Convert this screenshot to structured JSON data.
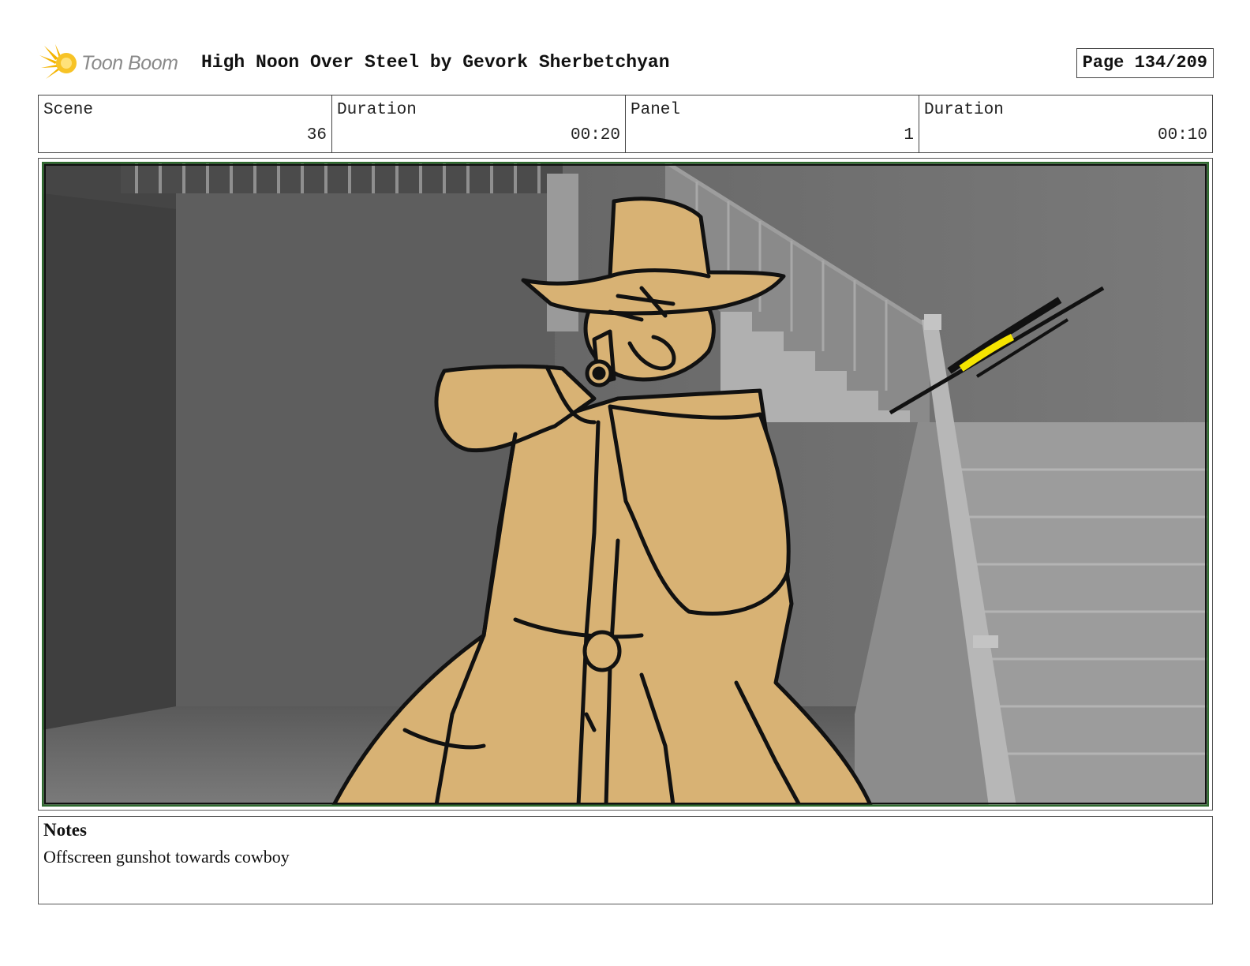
{
  "header": {
    "logo_text": "Toon Boom",
    "title": "High Noon Over Steel by Gevork Sherbetchyan",
    "page": "Page 134/209"
  },
  "info": {
    "scene_label": "Scene",
    "scene_value": "36",
    "scene_duration_label": "Duration",
    "scene_duration_value": "00:20",
    "panel_label": "Panel",
    "panel_value": "1",
    "panel_duration_label": "Duration",
    "panel_duration_value": "00:10"
  },
  "colors": {
    "figure_fill": "#d8b274",
    "background_gray": "#6e6e6e",
    "frame_border": "#2f6b2f",
    "muzzle_flash": "#f5e400"
  },
  "notes": {
    "title": "Notes",
    "body": "Offscreen gunshot towards cowboy"
  }
}
